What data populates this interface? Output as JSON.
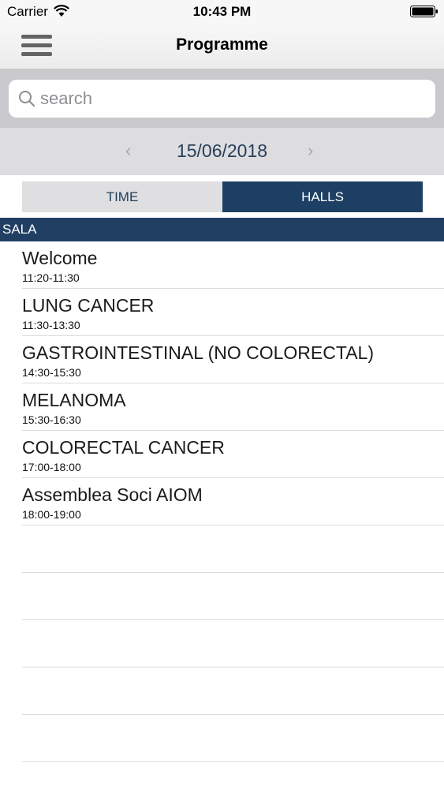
{
  "status_bar": {
    "carrier": "Carrier",
    "time": "10:43 PM"
  },
  "nav": {
    "title": "Programme"
  },
  "search": {
    "placeholder": "search",
    "value": ""
  },
  "date_nav": {
    "prev": "‹",
    "date": "15/06/2018",
    "next": "›"
  },
  "tabs": [
    {
      "label": "TIME",
      "active": false
    },
    {
      "label": "HALLS",
      "active": true
    }
  ],
  "section": {
    "title": "SALA"
  },
  "sessions": [
    {
      "title": "Welcome",
      "time": "11:20-11:30"
    },
    {
      "title": "LUNG CANCER",
      "time": "11:30-13:30"
    },
    {
      "title": "GASTROINTESTINAL (NO COLORECTAL)",
      "time": "14:30-15:30"
    },
    {
      "title": "MELANOMA",
      "time": "15:30-16:30"
    },
    {
      "title": "COLORECTAL CANCER",
      "time": "17:00-18:00"
    },
    {
      "title": "Assemblea Soci AIOM",
      "time": "18:00-19:00"
    }
  ],
  "colors": {
    "accent": "#1d3f63",
    "section_header": "#203f63",
    "date_text": "#283f5b"
  }
}
